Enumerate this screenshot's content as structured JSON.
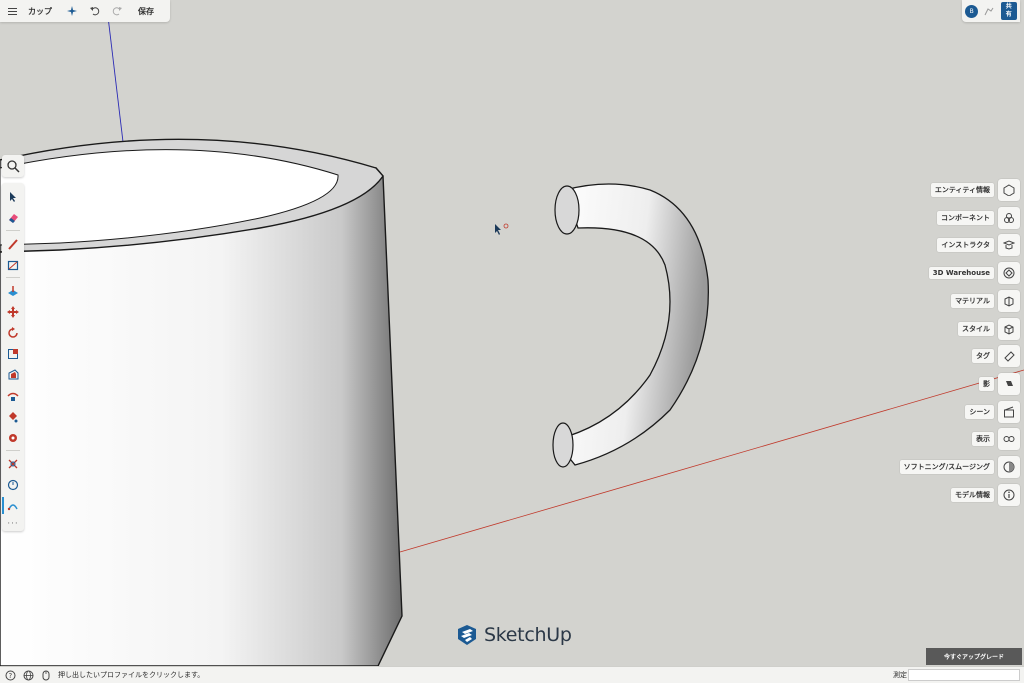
{
  "toolbar": {
    "file_name": "カップ",
    "save_label": "保存"
  },
  "account": {
    "avatar_initial": "B",
    "share_label_line1": "共",
    "share_label_line2": "有"
  },
  "panels": [
    {
      "label": "エンティティ情報",
      "icon": "entity-info-icon"
    },
    {
      "label": "コンポーネント",
      "icon": "components-icon"
    },
    {
      "label": "インストラクタ",
      "icon": "instructor-icon"
    },
    {
      "label": "3D Warehouse",
      "icon": "warehouse-icon"
    },
    {
      "label": "マテリアル",
      "icon": "materials-icon"
    },
    {
      "label": "スタイル",
      "icon": "styles-icon"
    },
    {
      "label": "タグ",
      "icon": "tags-icon"
    },
    {
      "label": "影",
      "icon": "shadows-icon"
    },
    {
      "label": "シーン",
      "icon": "scenes-icon"
    },
    {
      "label": "表示",
      "icon": "display-icon"
    },
    {
      "label": "ソフトニング/スムージング",
      "icon": "soften-icon"
    },
    {
      "label": "モデル情報",
      "icon": "model-info-icon"
    }
  ],
  "logo": {
    "text": "SketchUp"
  },
  "upgrade": {
    "label": "今すぐアップグレード"
  },
  "status": {
    "message": "押し出したいプロファイルをクリックします。",
    "measure_label": "測定"
  },
  "colors": {
    "accent": "#2a8fd0",
    "brand": "#1c5a93",
    "red_axis": "#c0392b",
    "blue_axis": "#2b2bb5"
  }
}
